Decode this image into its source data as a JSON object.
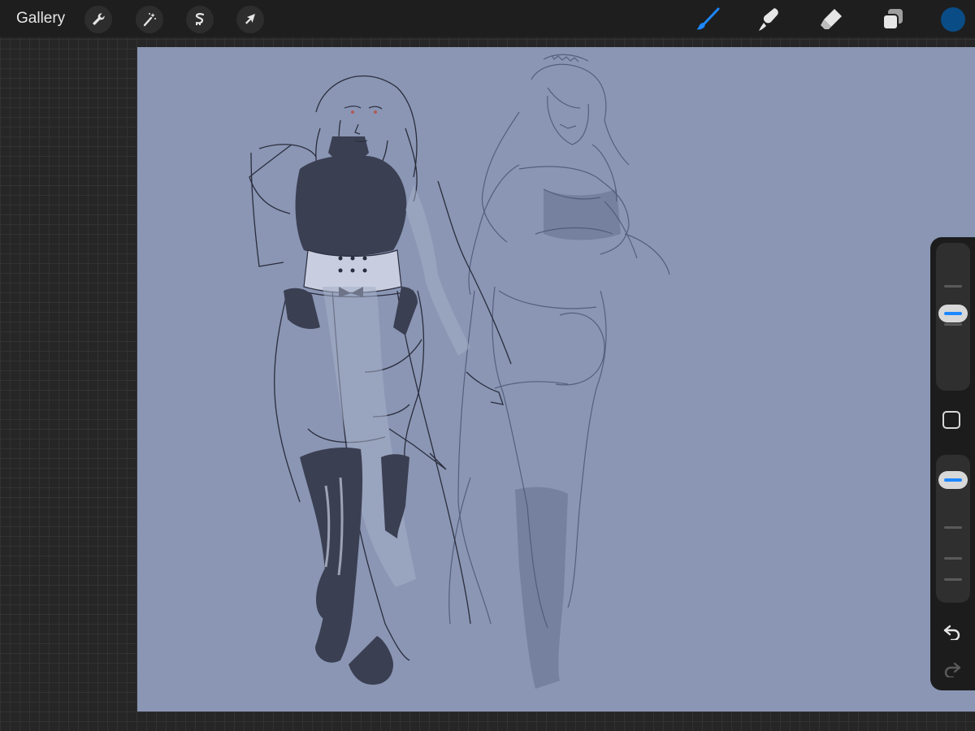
{
  "topbar": {
    "gallery_label": "Gallery",
    "left_tools": [
      {
        "name": "actions",
        "icon": "wrench-icon"
      },
      {
        "name": "adjustments",
        "icon": "magic-wand-icon"
      },
      {
        "name": "selection",
        "icon": "selection-s-icon"
      },
      {
        "name": "transform",
        "icon": "arrow-cursor-icon"
      }
    ],
    "right_tools": [
      {
        "name": "brush",
        "icon": "brush-icon",
        "active": true
      },
      {
        "name": "smudge",
        "icon": "smudge-finger-icon",
        "active": false
      },
      {
        "name": "eraser",
        "icon": "eraser-icon",
        "active": false
      },
      {
        "name": "layers",
        "icon": "layers-icon",
        "active": false
      }
    ],
    "current_color": "#0a4c86"
  },
  "sidebar": {
    "brush_size_level": 0.53,
    "opacity_level": 0.92,
    "modify_icon": "square-modify-icon",
    "undo_icon": "undo-arrow-icon",
    "redo_icon": "redo-arrow-icon",
    "redo_enabled": false
  },
  "canvas": {
    "background_color": "#8a96b4",
    "sketch_line_color": "#2a2d3c",
    "sketch_light_color": "#4f5a78",
    "boot_fill_color": "#3b3f52",
    "skin_tone_color": "#a6b0c8"
  },
  "theme": {
    "accent": "#1e88ff",
    "icon_color": "#e6e6e6",
    "topbar_bg": "#1e1e1e"
  }
}
